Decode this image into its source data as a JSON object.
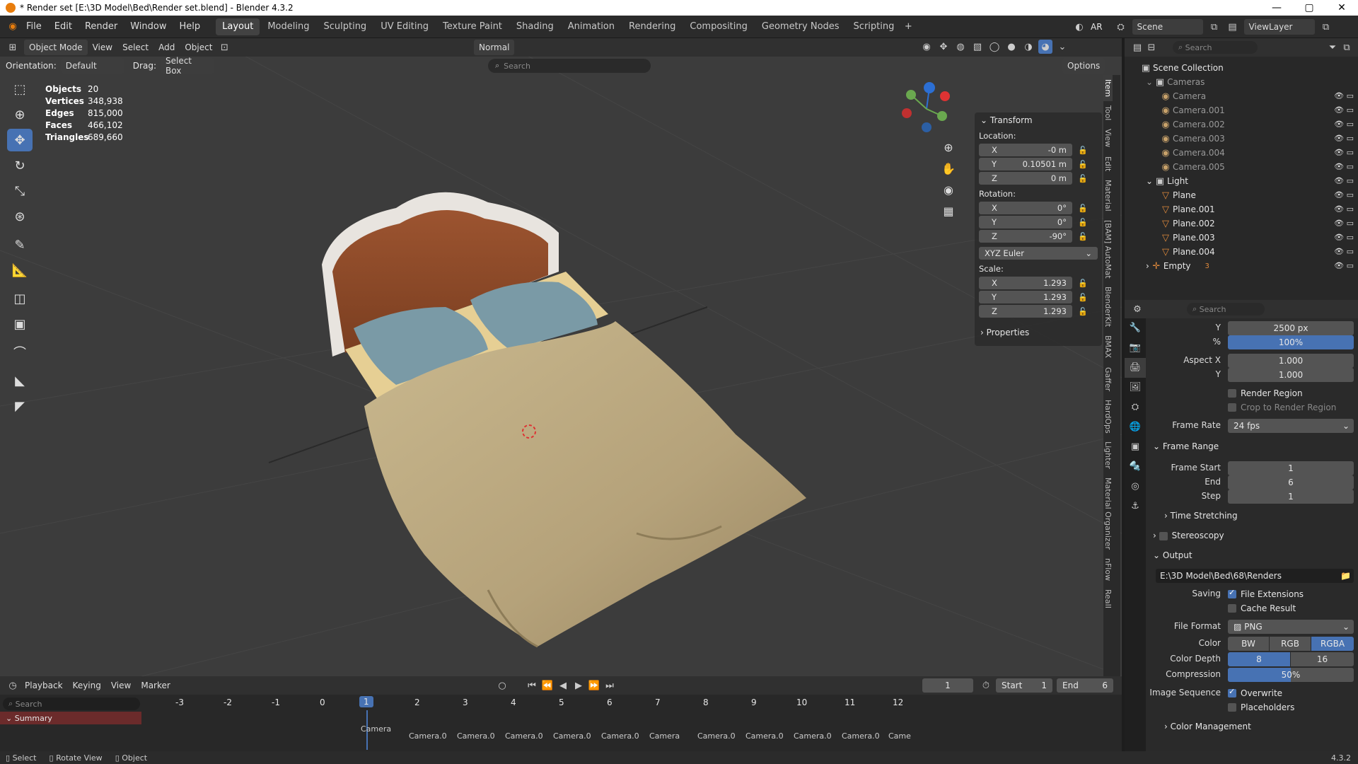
{
  "title": "* Render set [E:\\3D Model\\Bed\\Render set.blend] - Blender 4.3.2",
  "menus": [
    "File",
    "Edit",
    "Render",
    "Window",
    "Help"
  ],
  "workspaces": [
    "Layout",
    "Modeling",
    "Sculpting",
    "UV Editing",
    "Texture Paint",
    "Shading",
    "Animation",
    "Rendering",
    "Compositing",
    "Geometry Nodes",
    "Scripting"
  ],
  "topright": {
    "lang": "AR",
    "scene": "Scene",
    "viewlayer": "ViewLayer"
  },
  "vp_header": {
    "mode": "Object Mode",
    "view": "View",
    "select": "Select",
    "add": "Add",
    "object": "Object",
    "orientation_label": "Orientation:",
    "orientation": "Default",
    "drag_label": "Drag:",
    "drag": "Select Box",
    "normal": "Normal",
    "search_placeholder": "Search",
    "options": "Options"
  },
  "stats": {
    "objects_label": "Objects",
    "objects": "20",
    "vertices_label": "Vertices",
    "vertices": "348,938",
    "edges_label": "Edges",
    "edges": "815,000",
    "faces_label": "Faces",
    "faces": "466,102",
    "triangles_label": "Triangles",
    "triangles": "689,660"
  },
  "transform": {
    "header": "Transform",
    "location_label": "Location:",
    "loc_x": "-0 m",
    "loc_y": "0.10501 m",
    "loc_z": "0 m",
    "rotation_label": "Rotation:",
    "rot_x": "0°",
    "rot_y": "0°",
    "rot_z": "-90°",
    "rotation_mode": "XYZ Euler",
    "scale_label": "Scale:",
    "scale_x": "1.293",
    "scale_y": "1.293",
    "scale_z": "1.293",
    "properties": "Properties",
    "axis_x": "X",
    "axis_y": "Y",
    "axis_z": "Z"
  },
  "side_tabs": [
    "Item",
    "Tool",
    "View",
    "Edit",
    "Material",
    "[BAM] AutoMat",
    "BlenderKit",
    "BMAX",
    "Gaffer",
    "HardOps",
    "Lighter",
    "Material Organizer",
    "nFlow",
    "RealI"
  ],
  "outliner": {
    "search_placeholder": "Search",
    "collection": "Scene Collection",
    "cameras": "Cameras",
    "camera_items": [
      "Camera",
      "Camera.001",
      "Camera.002",
      "Camera.003",
      "Camera.004",
      "Camera.005"
    ],
    "light": "Light",
    "light_items": [
      "Plane",
      "Plane.001",
      "Plane.002",
      "Plane.003",
      "Plane.004"
    ],
    "empty": "Empty",
    "empty_count": "3"
  },
  "props": {
    "search_placeholder": "Search",
    "res_y_label": "Y",
    "res_y": "2500 px",
    "pct_label": "%",
    "pct": "100%",
    "aspect_x_label": "Aspect X",
    "aspect_x": "1.000",
    "aspect_y_label": "Y",
    "aspect_y": "1.000",
    "render_region": "Render Region",
    "crop": "Crop to Render Region",
    "frame_rate_label": "Frame Rate",
    "frame_rate": "24 fps",
    "frame_range": "Frame Range",
    "frame_start_label": "Frame Start",
    "frame_start": "1",
    "end_label": "End",
    "end": "6",
    "step_label": "Step",
    "step": "1",
    "time_stretching": "Time Stretching",
    "stereoscopy": "Stereoscopy",
    "output": "Output",
    "output_path": "E:\\3D Model\\Bed\\68\\Renders",
    "saving_label": "Saving",
    "file_ext": "File Extensions",
    "cache": "Cache Result",
    "file_format_label": "File Format",
    "file_format": "PNG",
    "color_label": "Color",
    "bw": "BW",
    "rgb": "RGB",
    "rgba": "RGBA",
    "depth_label": "Color Depth",
    "depth8": "8",
    "depth16": "16",
    "compression_label": "Compression",
    "compression": "50%",
    "compression_value": 0.5,
    "image_seq_label": "Image Sequence",
    "overwrite": "Overwrite",
    "placeholders": "Placeholders",
    "color_mgmt": "Color Management"
  },
  "timeline": {
    "playback": "Playback",
    "keying": "Keying",
    "view": "View",
    "marker": "Marker",
    "current": "1",
    "start_label": "Start",
    "start": "1",
    "end_label": "End",
    "end": "6",
    "search_placeholder": "Search",
    "summary": "Summary",
    "ticks": [
      "-3",
      "-2",
      "-1",
      "0",
      "1",
      "2",
      "3",
      "4",
      "5",
      "6",
      "7",
      "8",
      "9",
      "10",
      "11",
      "12"
    ],
    "markers": [
      "Camera",
      "Camera.0",
      "Camera.0",
      "Camera.0",
      "Camera.0",
      "Camera.0",
      "Camera",
      "Camera.0",
      "Camera.0",
      "Camera.0",
      "Camera.0",
      "Came"
    ]
  },
  "status": {
    "select": "Select",
    "rotate": "Rotate View",
    "object": "Object",
    "version": "4.3.2"
  },
  "colors": {
    "accent": "#4772b3",
    "sheet": "#b5a27a",
    "pillow": "#7a9aa6",
    "headboard": "#8a4a2a"
  }
}
